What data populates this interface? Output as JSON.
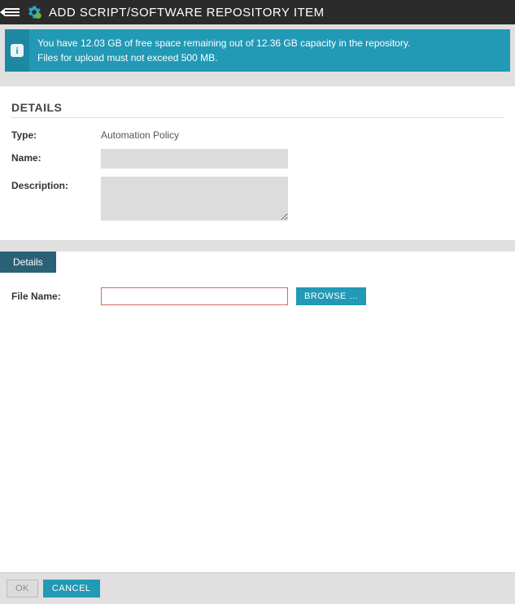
{
  "header": {
    "title": "ADD SCRIPT/SOFTWARE REPOSITORY ITEM"
  },
  "info": {
    "line1": "You have 12.03 GB of free space remaining out of 12.36 GB capacity in the repository.",
    "line2": "Files for upload must not exceed 500 MB."
  },
  "details": {
    "section_title": "DETAILS",
    "type_label": "Type:",
    "type_value": "Automation Policy",
    "name_label": "Name:",
    "name_value": "",
    "description_label": "Description:",
    "description_value": ""
  },
  "tabs": {
    "details_tab": "Details"
  },
  "file": {
    "label": "File Name:",
    "value": "",
    "browse_label": "BROWSE ..."
  },
  "footer": {
    "ok_label": "OK",
    "cancel_label": "CANCEL"
  }
}
